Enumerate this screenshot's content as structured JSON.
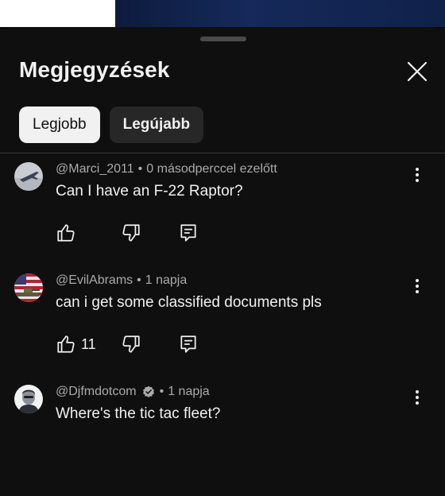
{
  "panel": {
    "title": "Megjegyzések",
    "sort_chips": [
      {
        "label": "Legjobb",
        "active": true
      },
      {
        "label": "Legújabb",
        "active": false
      }
    ]
  },
  "comments": [
    {
      "handle": "@Marci_2011",
      "verified": false,
      "time": "0 másodperccel ezelőtt",
      "text": "Can I have an F-22 Raptor?",
      "likes": "",
      "avatar": "jet-avatar"
    },
    {
      "handle": "@EvilAbrams",
      "verified": false,
      "time": "1 napja",
      "text": "can i get some classified documents pls",
      "likes": "11",
      "avatar": "flag-tank-avatar"
    },
    {
      "handle": "@Djfmdotcom",
      "verified": true,
      "time": "1 napja",
      "text": "Where's the tic tac fleet?",
      "likes": "",
      "avatar": "person-avatar"
    }
  ],
  "colors": {
    "background": "#0f0f0f",
    "text_primary": "#f1f1f1",
    "text_secondary": "#aaaaaa",
    "chip_inactive": "#272727"
  },
  "icons": [
    "close-icon",
    "like-icon",
    "dislike-icon",
    "reply-icon",
    "more-options-icon",
    "verified-icon"
  ]
}
